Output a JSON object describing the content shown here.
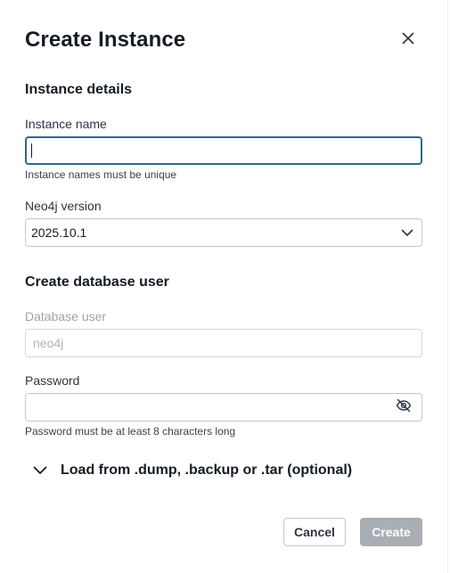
{
  "dialog": {
    "title": "Create Instance",
    "close_icon": "close-icon"
  },
  "instance_details": {
    "heading": "Instance details",
    "name_label": "Instance name",
    "name_value": "",
    "name_helper": "Instance names must be unique",
    "version_label": "Neo4j version",
    "version_value": "2025.10.1",
    "version_icon": "chevron-down-icon"
  },
  "database_user": {
    "heading": "Create database user",
    "user_label": "Database user",
    "user_placeholder": "neo4j",
    "password_label": "Password",
    "password_value": "",
    "password_helper": "Password must be at least 8 characters long",
    "visibility_icon": "eye-off-icon"
  },
  "load_section": {
    "label": "Load from .dump, .backup or .tar (optional)",
    "icon": "chevron-down-icon"
  },
  "actions": {
    "cancel_label": "Cancel",
    "create_label": "Create"
  },
  "colors": {
    "focus_border": "#2f6a7f",
    "text": "#151b24",
    "disabled_button": "#a9adb4"
  }
}
